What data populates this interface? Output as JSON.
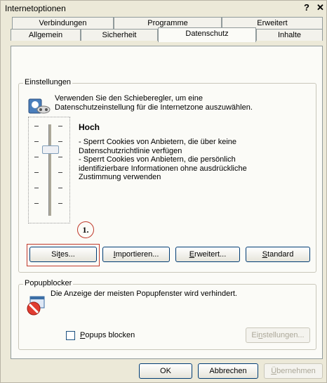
{
  "window": {
    "title": "Internetoptionen",
    "help": "?",
    "close": "✕"
  },
  "tabs": {
    "row_back": [
      "Verbindungen",
      "Programme",
      "Erweitert"
    ],
    "row_front": [
      "Allgemein",
      "Sicherheit",
      "Datenschutz",
      "Inhalte"
    ],
    "active": "Datenschutz"
  },
  "settings": {
    "group_label": "Einstellungen",
    "intro_line1": "Verwenden Sie den Schieberegler, um eine",
    "intro_line2": "Datenschutzeinstellung für die Internetzone auszuwählen.",
    "level": "Hoch",
    "desc_lines": [
      "- Sperrt Cookies von Anbietern, die über keine",
      "Datenschutzrichtlinie verfügen",
      "- Sperrt Cookies von Anbietern, die persönlich",
      "identifizierbare Informationen ohne ausdrückliche",
      "Zustimmung verwenden"
    ],
    "annotation": "1.",
    "buttons": {
      "sites_pre": "Si",
      "sites_mn": "t",
      "sites_post": "es...",
      "import_mn": "I",
      "import_post": "mportieren...",
      "adv_mn": "E",
      "adv_post": "rweitert...",
      "std_mn": "S",
      "std_post": "tandard"
    }
  },
  "popup": {
    "group_label": "Popupblocker",
    "desc": "Die Anzeige der meisten Popupfenster wird verhindert.",
    "checkbox_mn": "P",
    "checkbox_post": "opups blocken",
    "settings_pre": "Ei",
    "settings_mn": "n",
    "settings_post": "stellungen..."
  },
  "footer": {
    "ok": "OK",
    "cancel": "Abbrechen",
    "apply_mn": "Ü",
    "apply_post": "bernehmen"
  }
}
